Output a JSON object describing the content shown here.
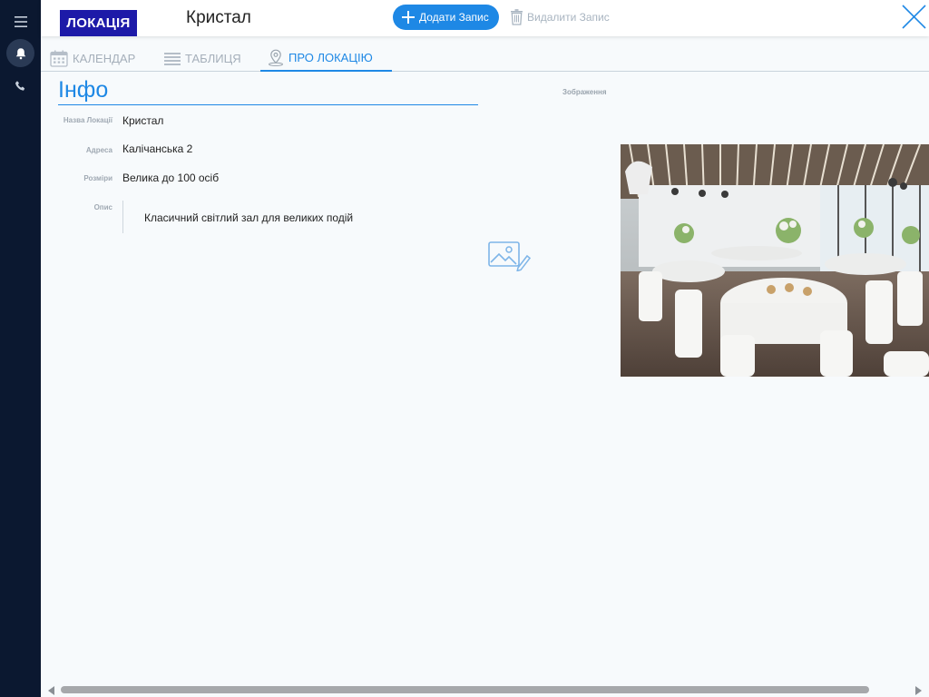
{
  "header": {
    "badge": "ЛОКАЦІЯ",
    "record_title": "Кристал",
    "add_label": "Додати Запис",
    "delete_label": "Видалити Запис"
  },
  "tabs": [
    {
      "label": "КАЛЕНДАР",
      "icon": "calendar-icon"
    },
    {
      "label": "ТАБЛИЦЯ",
      "icon": "table-icon"
    },
    {
      "label": "ПРО ЛОКАЦІЮ",
      "icon": "location-pin-icon",
      "active": true
    }
  ],
  "info": {
    "section_title": "Інфо",
    "image_header": "Зображення",
    "fields": {
      "name": {
        "label": "Назва Локації",
        "value": "Кристал"
      },
      "address": {
        "label": "Адреса",
        "value": "Калічанська 2"
      },
      "size": {
        "label": "Розміри",
        "value": "Велика до 100 осіб"
      },
      "description": {
        "label": "Опис",
        "value": "Класичний світлий зал для великих подій"
      }
    }
  },
  "sidebar": {
    "icons": [
      "menu-icon",
      "bell-icon",
      "phone-icon"
    ]
  },
  "colors": {
    "accent": "#1e88e5",
    "badge": "#1d1aa8",
    "sidebar": "#0b1830",
    "background": "#f7fafc"
  }
}
